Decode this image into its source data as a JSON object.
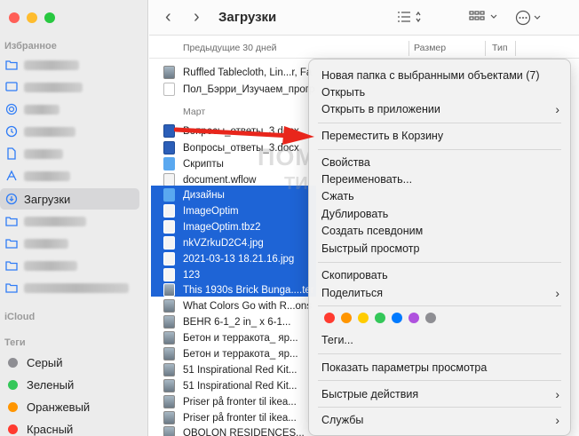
{
  "sidebar": {
    "favorites_heading": "Избранное",
    "downloads_label": "Загрузки",
    "icloud_heading": "iCloud",
    "tags_heading": "Теги",
    "tags": [
      {
        "label": "Серый",
        "color": "#8e8e93"
      },
      {
        "label": "Зеленый",
        "color": "#34c759"
      },
      {
        "label": "Оранжевый",
        "color": "#ff9500"
      },
      {
        "label": "Красный",
        "color": "#ff3b30"
      }
    ]
  },
  "toolbar": {
    "title": "Загрузки",
    "back_icon": "chevron-left-icon",
    "forward_icon": "chevron-right-icon"
  },
  "columns": {
    "name": "Предыдущие 30 дней",
    "size": "Размер",
    "type": "Тип"
  },
  "files_recent": [
    {
      "name": "Ruffled Tablecloth, Lin...r, Fa",
      "icon": "fi-img"
    },
    {
      "name": "Пол_Бэрри_Изучаем_прогр",
      "icon": "fi-doc"
    }
  ],
  "month_label": "Март",
  "files_march": [
    {
      "name": "Вопросы_ответы_3.docx",
      "icon": "fi-word"
    },
    {
      "name": "Вопросы_ответы_3.docx",
      "icon": "fi-word"
    },
    {
      "name": "Скрипты",
      "icon": "fi-folder"
    },
    {
      "name": "document.wflow",
      "icon": "fi-white"
    }
  ],
  "files_selected": [
    {
      "name": "Дизайны",
      "icon": "fi-folder"
    },
    {
      "name": "ImageOptim",
      "icon": "fi-white"
    },
    {
      "name": "ImageOptim.tbz2",
      "icon": "fi-white"
    },
    {
      "name": "nkVZrkuD2C4.jpg",
      "icon": "fi-white"
    },
    {
      "name": "2021-03-13 18.21.16.jpg",
      "icon": "fi-white"
    },
    {
      "name": "123",
      "icon": "fi-white"
    },
    {
      "name": "This 1930s Brick Bunga....ter",
      "icon": "fi-img"
    }
  ],
  "files_after": [
    {
      "name": "What Colors Go with R...ons",
      "icon": "fi-img"
    },
    {
      "name": "BEHR 6-1_2 in_ x 6-1...",
      "icon": "fi-img"
    },
    {
      "name": "Бетон и терракота_ яр...",
      "icon": "fi-img"
    },
    {
      "name": "Бетон и терракота_ яр...",
      "icon": "fi-img"
    },
    {
      "name": "51 Inspirational Red Kit...",
      "icon": "fi-img"
    },
    {
      "name": "51 Inspirational Red Kit...",
      "icon": "fi-img"
    },
    {
      "name": "Priser på fronter til ikea...",
      "icon": "fi-img"
    },
    {
      "name": "Priser på fronter til ikea...",
      "icon": "fi-img"
    },
    {
      "name": "OBOLON RESIDENCES...",
      "icon": "fi-img"
    }
  ],
  "watermark": {
    "line1": "ПОМОЩЬ",
    "line2": "ТИКА"
  },
  "context_menu": {
    "new_folder": "Новая папка с выбранными объектами (7)",
    "open": "Открыть",
    "open_with": "Открыть в приложении",
    "move_to_trash": "Переместить в Корзину",
    "get_info": "Свойства",
    "rename": "Переименовать...",
    "compress": "Сжать",
    "duplicate": "Дублировать",
    "make_alias": "Создать псевдоним",
    "quick_look": "Быстрый просмотр",
    "copy": "Скопировать",
    "share": "Поделиться",
    "tags": "Теги...",
    "show_view_options": "Показать параметры просмотра",
    "quick_actions": "Быстрые действия",
    "services": "Службы",
    "tag_colors": [
      "#ff3b30",
      "#ff9500",
      "#ffcc00",
      "#34c759",
      "#007aff",
      "#af52de",
      "#8e8e93"
    ]
  },
  "arrow_color": "#e8261c"
}
